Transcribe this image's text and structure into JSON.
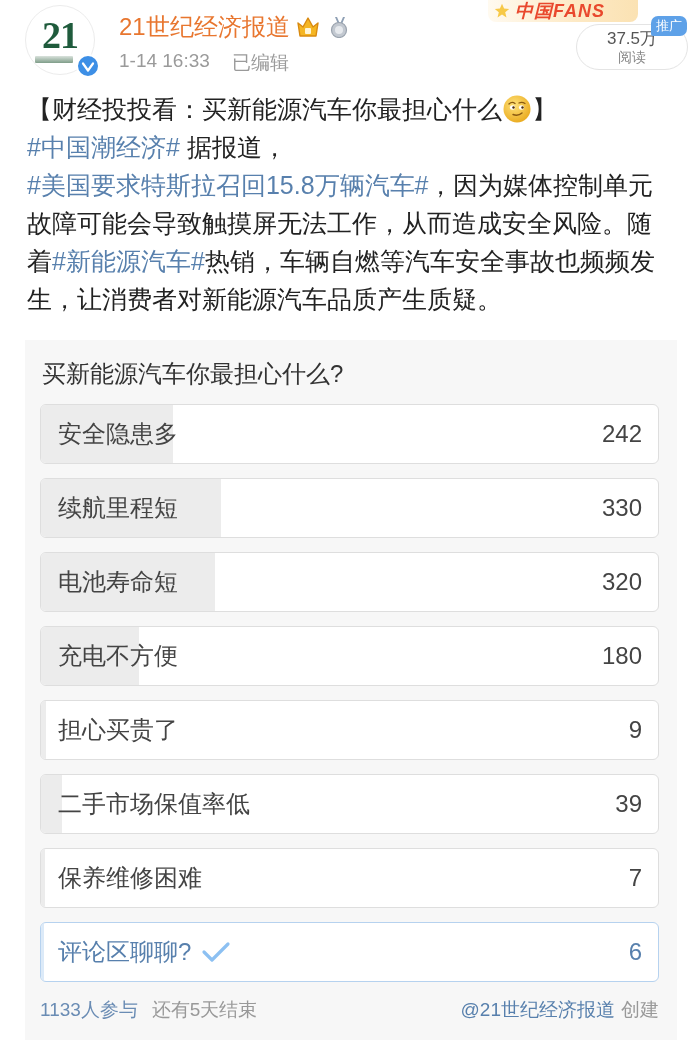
{
  "header": {
    "avatar_text": "21",
    "verified": true,
    "name": "21世纪经济报道",
    "badges": [
      {
        "kind": "crown"
      },
      {
        "kind": "medal"
      }
    ],
    "time": "1-14 16:33",
    "edited": "已编辑",
    "promo_text": "中国FANS",
    "read_count": "37.5万",
    "read_label": "阅读",
    "ad_tag": "推广"
  },
  "post": {
    "segments": [
      {
        "kind": "text",
        "text": "【财经投投看：买新能源汽车你最担心什么"
      },
      {
        "kind": "emoji"
      },
      {
        "kind": "text",
        "text": "】"
      },
      {
        "kind": "topic",
        "text": "#中国潮经济#"
      },
      {
        "kind": "text",
        "text": " 据报道，"
      },
      {
        "kind": "topic",
        "text": "#美国要求特斯拉召回15.8万辆汽车#"
      },
      {
        "kind": "text",
        "text": "，因为媒体控制单元故障可能会导致触摸屏无法工作，从而造成安全风险。随着"
      },
      {
        "kind": "topic",
        "text": "#新能源汽车#"
      },
      {
        "kind": "text",
        "text": "热销，车辆自燃等汽车安全事故也频频发生，让消费者对新能源汽车品质产生质疑。"
      }
    ]
  },
  "poll": {
    "question": "买新能源汽车你最担心什么?",
    "options": [
      {
        "label": "安全隐患多",
        "count": "242",
        "level": 0.214,
        "selected": false
      },
      {
        "label": "续航里程短",
        "count": "330",
        "level": 0.291,
        "selected": false
      },
      {
        "label": "电池寿命短",
        "count": "320",
        "level": 0.282,
        "selected": false
      },
      {
        "label": "充电不方便",
        "count": "180",
        "level": 0.159,
        "selected": false
      },
      {
        "label": "担心买贵了",
        "count": "9",
        "level": 0.008,
        "selected": false
      },
      {
        "label": "二手市场保值率低",
        "count": "39",
        "level": 0.034,
        "selected": false
      },
      {
        "label": "保养维修困难",
        "count": "7",
        "level": 0.006,
        "selected": false
      },
      {
        "label": "评论区聊聊?",
        "count": "6",
        "level": 0.005,
        "selected": true
      }
    ],
    "participants": "1133人参与",
    "remaining": "还有5天结束",
    "creator": "@21世纪经济报道",
    "creator_suffix": "创建"
  }
}
